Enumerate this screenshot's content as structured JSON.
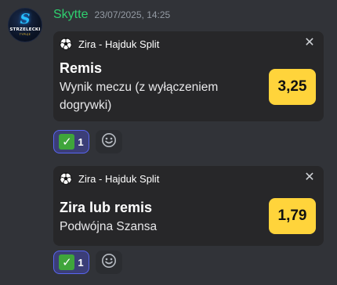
{
  "message": {
    "avatar": {
      "name": "avatar",
      "logo_letter": "S",
      "logo_text_main": "STRZELECKI",
      "logo_text_sub": "TYPUJE"
    },
    "username": "Skytte",
    "timestamp": "23/07/2025, 14:25"
  },
  "bets": [
    {
      "match": "Zira - Hajduk Split",
      "pick": "Remis",
      "market": "Wynik meczu (z wyłączeniem dogrywki)",
      "odds": "3,25",
      "close_icon": "close-icon",
      "sport_icon": "soccer-ball-icon"
    },
    {
      "match": "Zira - Hajduk Split",
      "pick": "Zira lub remis",
      "market": "Podwójna Szansa",
      "odds": "1,79",
      "close_icon": "close-icon",
      "sport_icon": "soccer-ball-icon"
    }
  ],
  "reactions": [
    {
      "emoji_icon": "check-mark-icon",
      "emoji": "✓",
      "count": "1",
      "add_icon": "add-reaction-smiley-icon"
    },
    {
      "emoji_icon": "check-mark-icon",
      "emoji": "✓",
      "count": "1",
      "add_icon": "add-reaction-smiley-icon"
    }
  ],
  "colors": {
    "background": "#313338",
    "card": "#272729",
    "username": "#2fd06f",
    "timestamp": "#949ba4",
    "odds_bg": "#ffd43b",
    "reaction_bg": "#3b3e77",
    "reaction_border": "#5865f2",
    "check_green": "#3fa53b"
  }
}
